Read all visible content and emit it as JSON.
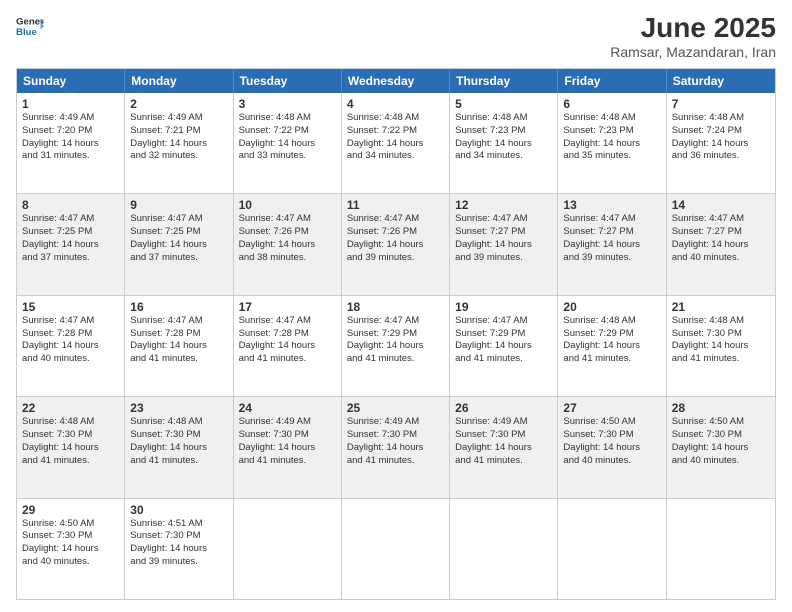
{
  "logo": {
    "line1": "General",
    "line2": "Blue"
  },
  "title": "June 2025",
  "location": "Ramsar, Mazandaran, Iran",
  "days": [
    "Sunday",
    "Monday",
    "Tuesday",
    "Wednesday",
    "Thursday",
    "Friday",
    "Saturday"
  ],
  "rows": [
    {
      "shade": "white",
      "cells": [
        {
          "day": "1",
          "lines": [
            "Sunrise: 4:49 AM",
            "Sunset: 7:20 PM",
            "Daylight: 14 hours",
            "and 31 minutes."
          ]
        },
        {
          "day": "2",
          "lines": [
            "Sunrise: 4:49 AM",
            "Sunset: 7:21 PM",
            "Daylight: 14 hours",
            "and 32 minutes."
          ]
        },
        {
          "day": "3",
          "lines": [
            "Sunrise: 4:48 AM",
            "Sunset: 7:22 PM",
            "Daylight: 14 hours",
            "and 33 minutes."
          ]
        },
        {
          "day": "4",
          "lines": [
            "Sunrise: 4:48 AM",
            "Sunset: 7:22 PM",
            "Daylight: 14 hours",
            "and 34 minutes."
          ]
        },
        {
          "day": "5",
          "lines": [
            "Sunrise: 4:48 AM",
            "Sunset: 7:23 PM",
            "Daylight: 14 hours",
            "and 34 minutes."
          ]
        },
        {
          "day": "6",
          "lines": [
            "Sunrise: 4:48 AM",
            "Sunset: 7:23 PM",
            "Daylight: 14 hours",
            "and 35 minutes."
          ]
        },
        {
          "day": "7",
          "lines": [
            "Sunrise: 4:48 AM",
            "Sunset: 7:24 PM",
            "Daylight: 14 hours",
            "and 36 minutes."
          ]
        }
      ]
    },
    {
      "shade": "shaded",
      "cells": [
        {
          "day": "8",
          "lines": [
            "Sunrise: 4:47 AM",
            "Sunset: 7:25 PM",
            "Daylight: 14 hours",
            "and 37 minutes."
          ]
        },
        {
          "day": "9",
          "lines": [
            "Sunrise: 4:47 AM",
            "Sunset: 7:25 PM",
            "Daylight: 14 hours",
            "and 37 minutes."
          ]
        },
        {
          "day": "10",
          "lines": [
            "Sunrise: 4:47 AM",
            "Sunset: 7:26 PM",
            "Daylight: 14 hours",
            "and 38 minutes."
          ]
        },
        {
          "day": "11",
          "lines": [
            "Sunrise: 4:47 AM",
            "Sunset: 7:26 PM",
            "Daylight: 14 hours",
            "and 39 minutes."
          ]
        },
        {
          "day": "12",
          "lines": [
            "Sunrise: 4:47 AM",
            "Sunset: 7:27 PM",
            "Daylight: 14 hours",
            "and 39 minutes."
          ]
        },
        {
          "day": "13",
          "lines": [
            "Sunrise: 4:47 AM",
            "Sunset: 7:27 PM",
            "Daylight: 14 hours",
            "and 39 minutes."
          ]
        },
        {
          "day": "14",
          "lines": [
            "Sunrise: 4:47 AM",
            "Sunset: 7:27 PM",
            "Daylight: 14 hours",
            "and 40 minutes."
          ]
        }
      ]
    },
    {
      "shade": "white",
      "cells": [
        {
          "day": "15",
          "lines": [
            "Sunrise: 4:47 AM",
            "Sunset: 7:28 PM",
            "Daylight: 14 hours",
            "and 40 minutes."
          ]
        },
        {
          "day": "16",
          "lines": [
            "Sunrise: 4:47 AM",
            "Sunset: 7:28 PM",
            "Daylight: 14 hours",
            "and 41 minutes."
          ]
        },
        {
          "day": "17",
          "lines": [
            "Sunrise: 4:47 AM",
            "Sunset: 7:28 PM",
            "Daylight: 14 hours",
            "and 41 minutes."
          ]
        },
        {
          "day": "18",
          "lines": [
            "Sunrise: 4:47 AM",
            "Sunset: 7:29 PM",
            "Daylight: 14 hours",
            "and 41 minutes."
          ]
        },
        {
          "day": "19",
          "lines": [
            "Sunrise: 4:47 AM",
            "Sunset: 7:29 PM",
            "Daylight: 14 hours",
            "and 41 minutes."
          ]
        },
        {
          "day": "20",
          "lines": [
            "Sunrise: 4:48 AM",
            "Sunset: 7:29 PM",
            "Daylight: 14 hours",
            "and 41 minutes."
          ]
        },
        {
          "day": "21",
          "lines": [
            "Sunrise: 4:48 AM",
            "Sunset: 7:30 PM",
            "Daylight: 14 hours",
            "and 41 minutes."
          ]
        }
      ]
    },
    {
      "shade": "shaded",
      "cells": [
        {
          "day": "22",
          "lines": [
            "Sunrise: 4:48 AM",
            "Sunset: 7:30 PM",
            "Daylight: 14 hours",
            "and 41 minutes."
          ]
        },
        {
          "day": "23",
          "lines": [
            "Sunrise: 4:48 AM",
            "Sunset: 7:30 PM",
            "Daylight: 14 hours",
            "and 41 minutes."
          ]
        },
        {
          "day": "24",
          "lines": [
            "Sunrise: 4:49 AM",
            "Sunset: 7:30 PM",
            "Daylight: 14 hours",
            "and 41 minutes."
          ]
        },
        {
          "day": "25",
          "lines": [
            "Sunrise: 4:49 AM",
            "Sunset: 7:30 PM",
            "Daylight: 14 hours",
            "and 41 minutes."
          ]
        },
        {
          "day": "26",
          "lines": [
            "Sunrise: 4:49 AM",
            "Sunset: 7:30 PM",
            "Daylight: 14 hours",
            "and 41 minutes."
          ]
        },
        {
          "day": "27",
          "lines": [
            "Sunrise: 4:50 AM",
            "Sunset: 7:30 PM",
            "Daylight: 14 hours",
            "and 40 minutes."
          ]
        },
        {
          "day": "28",
          "lines": [
            "Sunrise: 4:50 AM",
            "Sunset: 7:30 PM",
            "Daylight: 14 hours",
            "and 40 minutes."
          ]
        }
      ]
    },
    {
      "shade": "white",
      "cells": [
        {
          "day": "29",
          "lines": [
            "Sunrise: 4:50 AM",
            "Sunset: 7:30 PM",
            "Daylight: 14 hours",
            "and 40 minutes."
          ]
        },
        {
          "day": "30",
          "lines": [
            "Sunrise: 4:51 AM",
            "Sunset: 7:30 PM",
            "Daylight: 14 hours",
            "and 39 minutes."
          ]
        },
        {
          "day": "",
          "lines": []
        },
        {
          "day": "",
          "lines": []
        },
        {
          "day": "",
          "lines": []
        },
        {
          "day": "",
          "lines": []
        },
        {
          "day": "",
          "lines": []
        }
      ]
    }
  ]
}
